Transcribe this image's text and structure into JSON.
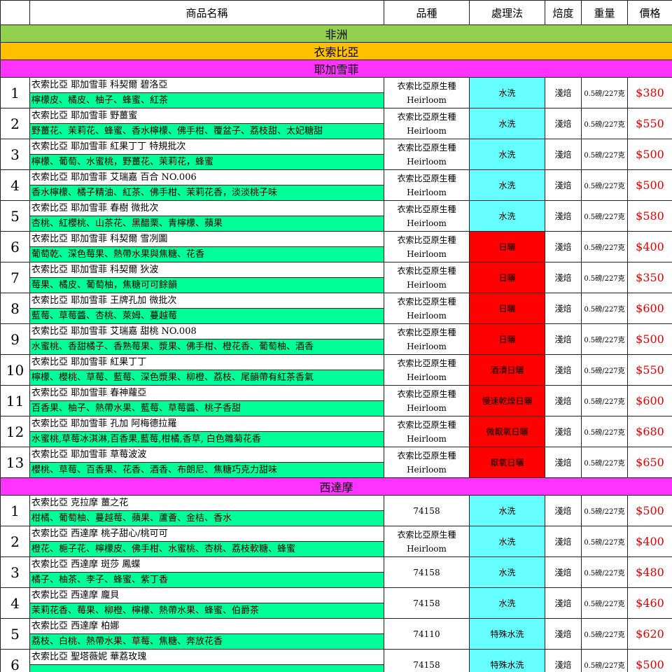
{
  "headers": {
    "name": "商品名稱",
    "variety": "品種",
    "process": "處理法",
    "roast": "焙度",
    "weight": "重量",
    "price": "價格"
  },
  "colors": {
    "region_bg": "#92d050",
    "country_bg": "#ffc000",
    "area_bg": "#ff33ff",
    "notes_bg": "#00ff99",
    "washed_bg": "#66ffff",
    "natural_bg": "#ff0000",
    "price_text": "#e00000"
  },
  "region": "非洲",
  "country": "衣索比亞",
  "area1": "耶加雪菲",
  "area2": "西達摩",
  "rows1": [
    {
      "num": "1",
      "name": "衣索比亞 耶加雪菲 科契爾 碧洛亞",
      "notes": "檸檬皮、橘皮、柚子、蜂蜜、紅茶",
      "variety1": "衣索比亞原生種",
      "variety2": "Heirloom",
      "process": "水洗",
      "ptype": "wash",
      "roast": "淺焙",
      "weight": "0.5磅/227克",
      "price": "$380"
    },
    {
      "num": "2",
      "name": "衣索比亞 耶加雪菲 野薑蜜",
      "notes": "野薑花、茉莉花、蜂蜜、香水檸檬、佛手柑、覆盆子、荔枝甜、太妃糖甜",
      "variety1": "衣索比亞原生種",
      "variety2": "Heirloom",
      "process": "水洗",
      "ptype": "wash",
      "roast": "淺焙",
      "weight": "0.5磅/227克",
      "price": "$550"
    },
    {
      "num": "3",
      "name": "衣索比亞 耶加雪菲 紅果丁丁 特規批次",
      "notes": "檸檬、葡萄、水蜜桃，野薑花、茉莉花，蜂蜜",
      "variety1": "衣索比亞原生種",
      "variety2": "Heirloom",
      "process": "水洗",
      "ptype": "wash",
      "roast": "淺焙",
      "weight": "0.5磅/227克",
      "price": "$500"
    },
    {
      "num": "4",
      "name": "衣索比亞 耶加雪菲 艾瑞嘉 百合 NO.006",
      "notes": "香水檸檬、橘子精油、紅茶、佛手柑、茉莉花香，淡淡桃子味",
      "variety1": "衣索比亞原生種",
      "variety2": "Heirloom",
      "process": "水洗",
      "ptype": "wash",
      "roast": "淺焙",
      "weight": "0.5磅/227克",
      "price": "$500"
    },
    {
      "num": "5",
      "name": "衣索比亞 耶加雪菲 春樹 微批次",
      "notes": "杏桃、紅櫻桃、山茶花、黑醋栗、青檸檬、蘋果",
      "variety1": "衣索比亞原生種",
      "variety2": "Heirloom",
      "process": "水洗",
      "ptype": "wash",
      "roast": "淺焙",
      "weight": "0.5磅/227克",
      "price": "$580"
    },
    {
      "num": "6",
      "name": "衣索比亞 耶加雪菲 科契爾 雪冽圖",
      "notes": "葡萄乾、深色莓果、熱帶水果與焦糖、花香",
      "variety1": "衣索比亞原生種",
      "variety2": "Heirloom",
      "process": "日曬",
      "ptype": "natural",
      "roast": "淺焙",
      "weight": "0.5磅/227克",
      "price": "$400"
    },
    {
      "num": "7",
      "name": "衣索比亞 耶加雪菲 科契爾 狄波",
      "notes": "莓果、橘皮、葡萄柚，焦糖可可餘韻",
      "variety1": "衣索比亞原生種",
      "variety2": "Heirloom",
      "process": "日曬",
      "ptype": "natural",
      "roast": "淺焙",
      "weight": "0.5磅/227克",
      "price": "$350"
    },
    {
      "num": "8",
      "name": "衣索比亞 耶加雪菲 王牌孔加 微批次",
      "notes": "藍莓、草莓醬、杏桃、萊姆、蔓越莓",
      "variety1": "衣索比亞原生種",
      "variety2": "Heirloom",
      "process": "日曬",
      "ptype": "natural",
      "roast": "淺焙",
      "weight": "0.5磅/227克",
      "price": "$600"
    },
    {
      "num": "9",
      "name": "衣索比亞 耶加雪菲 艾瑞嘉 甜桃 NO.008",
      "notes": "水蜜桃、香甜橘子、香熟莓果、漿果、佛手柑、橙花香、葡萄柚、酒香",
      "variety1": "衣索比亞原生種",
      "variety2": "Heirloom",
      "process": "日曬",
      "ptype": "natural",
      "roast": "淺焙",
      "weight": "0.5磅/227克",
      "price": "$500"
    },
    {
      "num": "10",
      "name": "衣索比亞 耶加雪菲 紅果丁丁",
      "notes": "檸檬、櫻桃、草莓、藍莓、深色漿果、柳橙、荔枝、尾韻帶有紅茶香氣",
      "variety1": "衣索比亞原生種",
      "variety2": "Heirloom",
      "process": "酒漬日曬",
      "ptype": "natural",
      "roast": "淺焙",
      "weight": "0.5磅/227克",
      "price": "$550"
    },
    {
      "num": "11",
      "name": "衣索比亞 耶加雪菲 春神蘿亞",
      "notes": "百香果、柚子、熱帶水果、藍莓、草莓醬、桃子香甜",
      "variety1": "衣索比亞原生種",
      "variety2": "Heirloom",
      "process": "慢速乾燥日曬",
      "ptype": "natural",
      "roast": "淺焙",
      "weight": "0.5磅/227克",
      "price": "$600"
    },
    {
      "num": "12",
      "name": "衣索比亞 耶加雪菲 孔加 阿梅德拉羅",
      "notes": "水蜜桃,草莓冰淇淋,百香果,藍莓,柑橘,香草, 白色雛菊花香",
      "variety1": "衣索比亞原生種",
      "variety2": "Heirloom",
      "process": "微厭氧日曬",
      "ptype": "natural",
      "roast": "淺焙",
      "weight": "0.5磅/227克",
      "price": "$680"
    },
    {
      "num": "13",
      "name": "衣索比亞 耶加雪菲 草莓波波",
      "notes": "櫻桃、草莓、百香果、花香、酒香、布朗尼、焦糖巧克力甜味",
      "variety1": "衣索比亞原生種",
      "variety2": "Heirloom",
      "process": "厭氧日曬",
      "ptype": "natural",
      "roast": "淺焙",
      "weight": "0.5磅/227克",
      "price": "$650"
    }
  ],
  "rows2": [
    {
      "num": "1",
      "name": "衣索比亞 克拉摩 薑之花",
      "notes": "柑橘、葡萄柚、蔓越莓、蘋果、蘆薈、金桔、香水",
      "variety1": "74158",
      "variety2": "",
      "process": "水洗",
      "ptype": "wash",
      "roast": "淺焙",
      "weight": "0.5磅/227克",
      "price": "$500"
    },
    {
      "num": "2",
      "name": "衣索比亞 西達摩 桃子甜心/桃可可",
      "notes": "橙花、梔子花、檸檬皮、佛手柑、水蜜桃、杏桃、荔枝軟糖、蜂蜜",
      "variety1": "衣索比亞原生種",
      "variety2": "Heirloom",
      "process": "水洗",
      "ptype": "wash",
      "roast": "淺焙",
      "weight": "0.5磅/227克",
      "price": "$400"
    },
    {
      "num": "3",
      "name": "衣索比亞 西達摩 斑莎 鳳蝶",
      "notes": "橘子、柚茶、李子、蜂蜜、紫丁香",
      "variety1": "74158",
      "variety2": "",
      "process": "水洗",
      "ptype": "wash",
      "roast": "淺焙",
      "weight": "0.5磅/227克",
      "price": "$480"
    },
    {
      "num": "4",
      "name": "衣索比亞 西達摩 龐貝",
      "notes": "茉莉花香、莓果、柳橙、檸檬、熱帶水果、蜂蜜、伯爵茶",
      "variety1": "74158",
      "variety2": "",
      "process": "水洗",
      "ptype": "wash",
      "roast": "淺焙",
      "weight": "0.5磅/227克",
      "price": "$460"
    },
    {
      "num": "5",
      "name": "衣索比亞 西達摩 柏娜",
      "notes": "荔枝、白桃、熱帶水果、草莓、焦糖、奔放花香",
      "variety1": "74110",
      "variety2": "",
      "process": "特殊水洗",
      "ptype": "wash",
      "roast": "淺焙",
      "weight": "0.5磅/227克",
      "price": "$620"
    },
    {
      "num": "6",
      "name": "衣索比亞 聖塔薇妮 華荔玫瑰",
      "notes": "",
      "variety1": "74158",
      "variety2": "",
      "process": "特殊水洗",
      "ptype": "wash",
      "roast": "淺焙",
      "weight": "0.5磅/227克",
      "price": "$500"
    }
  ]
}
